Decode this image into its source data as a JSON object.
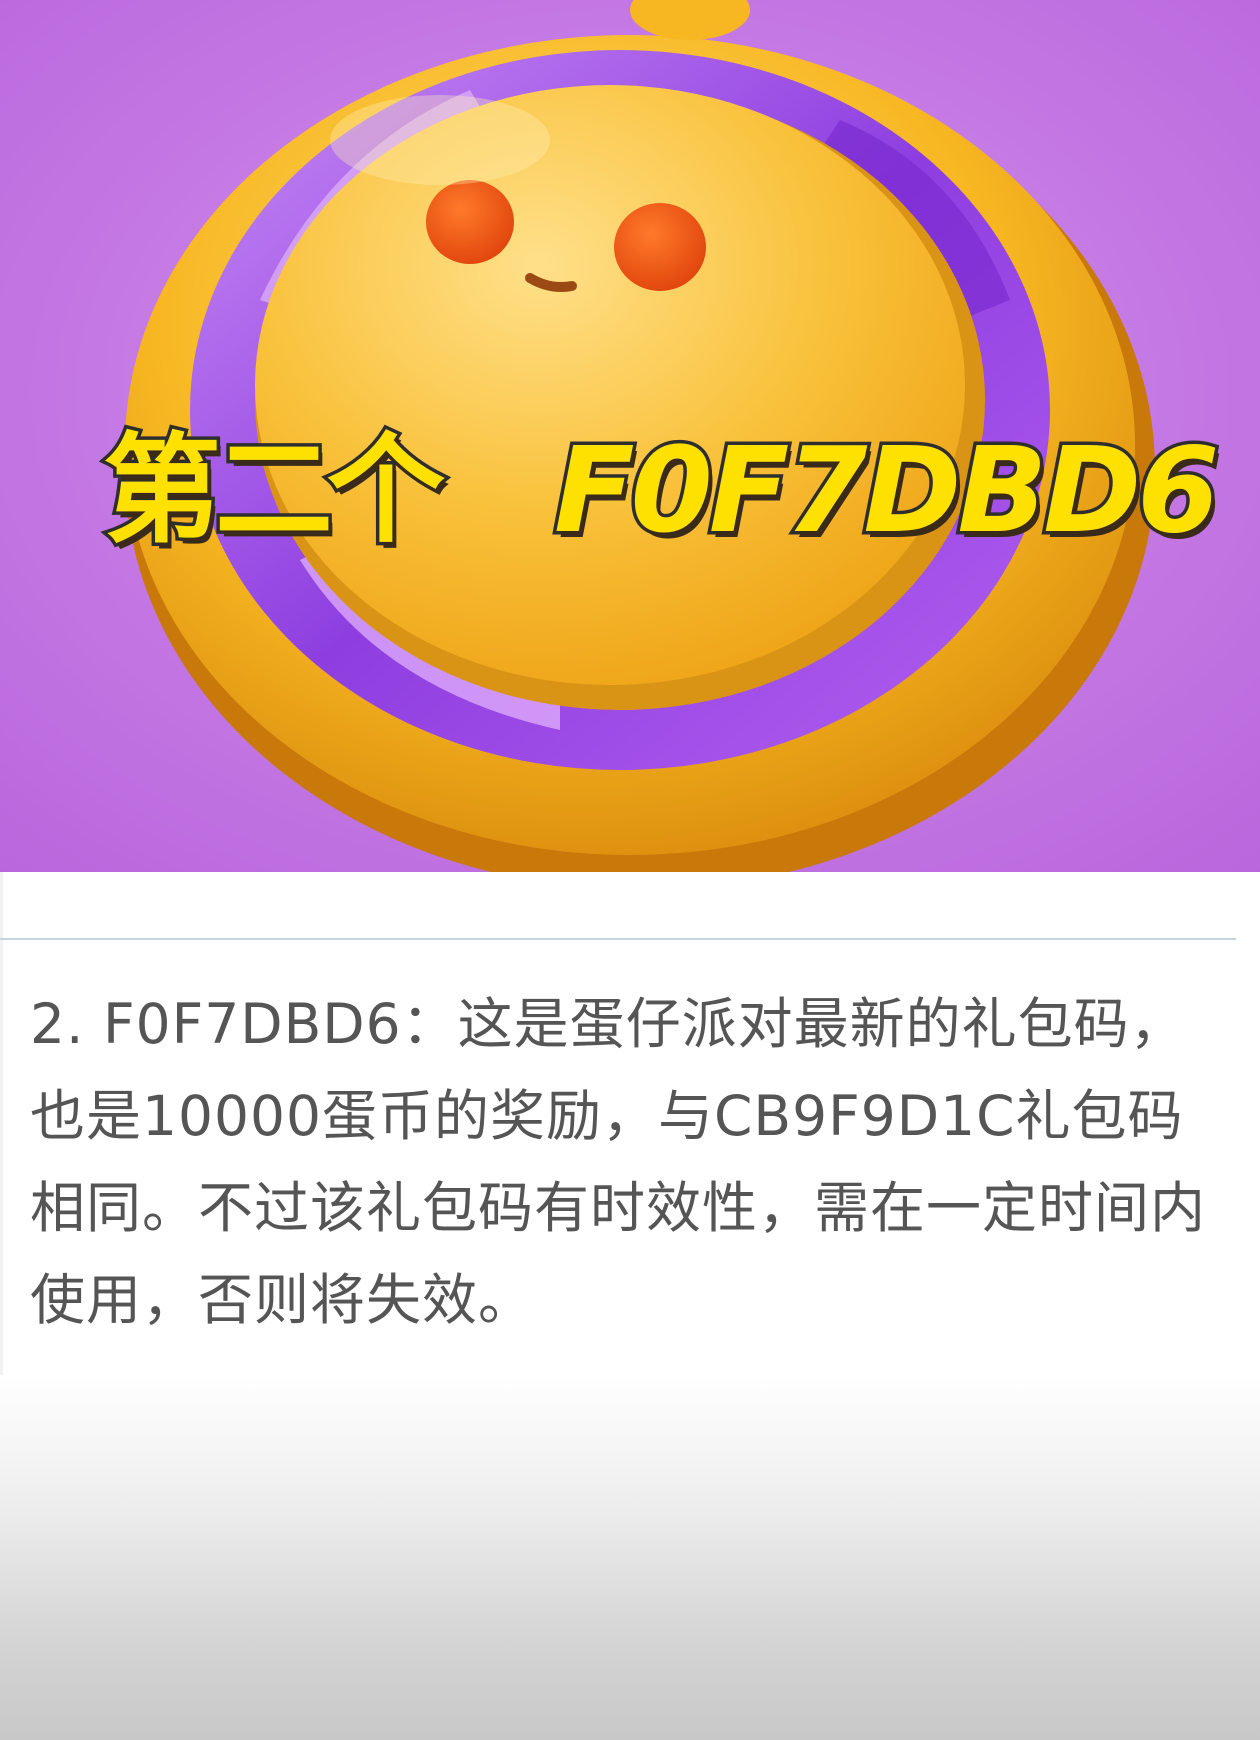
{
  "banner": {
    "overlay_label": "第二个",
    "overlay_code": "F0F7DBD6",
    "illustration": "golden-coin-character-icon",
    "colors": {
      "background": "#c77be4",
      "coin": "#f6b21a",
      "ring": "#9a4fe0",
      "text_fill": "#ffe100",
      "text_stroke": "#2e2e2e"
    }
  },
  "article": {
    "paragraph": "2. F0F7DBD6：这是蛋仔派对最新的礼包码，也是10000蛋币的奖励，与CB9F9D1C礼包码相同。不过该礼包码有时效性，需在一定时间内使用，否则将失效。"
  }
}
